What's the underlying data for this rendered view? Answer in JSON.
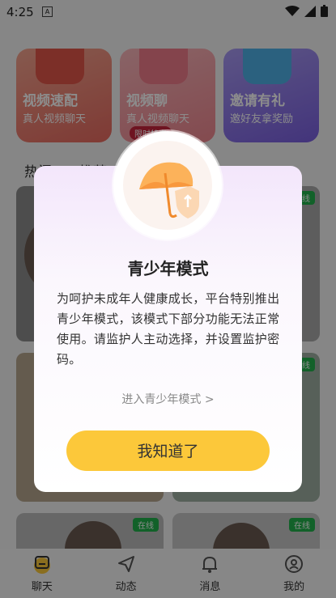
{
  "status_bar": {
    "time": "4:25",
    "sim_label": "A"
  },
  "cards": [
    {
      "title": "视频速配",
      "subtitle": "真人视频聊天",
      "color": "#f08a7c"
    },
    {
      "title": "视频聊",
      "subtitle": "真人视频聊天",
      "tag": "限时特惠",
      "color": "#f69aa3"
    },
    {
      "title": "邀请有礼",
      "subtitle": "邀好友拿奖励",
      "color": "#8a73e6"
    }
  ],
  "feed_tabs": [
    "热门",
    "推荐"
  ],
  "tiles": [
    {
      "online": "在线"
    },
    {
      "online": "在线"
    },
    {
      "online": "在线"
    },
    {
      "online": "在线"
    }
  ],
  "nav": {
    "items": [
      {
        "label": "聊天",
        "icon": "chat-icon",
        "active": true
      },
      {
        "label": "动态",
        "icon": "send-icon"
      },
      {
        "label": "消息",
        "icon": "bell-icon"
      },
      {
        "label": "我的",
        "icon": "user-icon"
      }
    ]
  },
  "dialog": {
    "title": "青少年模式",
    "body": "为呵护未成年人健康成长，平台特别推出青少年模式，该模式下部分功能无法正常使用。请监护人主动选择，并设置监护密码。",
    "link": "进入青少年模式 >",
    "button": "我知道了"
  },
  "colors": {
    "accent": "#fcc83a",
    "online": "#22b14c"
  }
}
